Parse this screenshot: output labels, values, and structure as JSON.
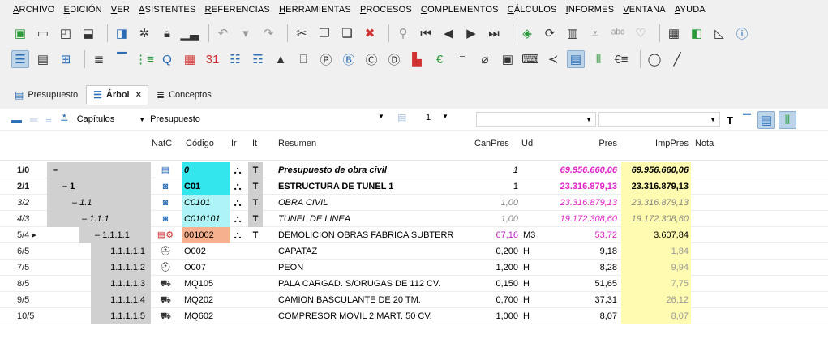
{
  "menu": [
    "ARCHIVO",
    "EDICIÓN",
    "VER",
    "ASISTENTES",
    "REFERENCIAS",
    "HERRAMIENTAS",
    "PROCESOS",
    "COMPLEMENTOS",
    "CÁLCULOS",
    "INFORMES",
    "VENTANA",
    "AYUDA"
  ],
  "tabs": [
    {
      "label": "Presupuesto",
      "icon": "table-icon"
    },
    {
      "label": "Árbol",
      "icon": "tree-icon",
      "close": "×"
    },
    {
      "label": "Conceptos",
      "icon": "list-icon"
    }
  ],
  "filter": {
    "level_label": "Capítulos",
    "view_select": "Presupuesto",
    "count_value": "1"
  },
  "columns": {
    "natc": "NatC",
    "codigo": "Código",
    "ir": "Ir",
    "it": "It",
    "resumen": "Resumen",
    "canpres": "CanPres",
    "ud": "Ud",
    "pres": "Pres",
    "imppres": "ImpPres",
    "nota": "Nota"
  },
  "rows": [
    {
      "id": "1/0",
      "tree": "–",
      "nat": "▤",
      "code": "0",
      "ir": "⛬",
      "it": "T",
      "resumen": "Presupuesto de obra civil",
      "canpres": "1",
      "ud": "",
      "pres": "69.956.660,06",
      "imppres": "69.956.660,06"
    },
    {
      "id": "2/1",
      "tree": "– 1",
      "nat": "◙",
      "code": "C01",
      "ir": "⛬",
      "it": "T",
      "resumen": "ESTRUCTURA DE TUNEL 1",
      "canpres": "1",
      "ud": "",
      "pres": "23.316.879,13",
      "imppres": "23.316.879,13"
    },
    {
      "id": "3/2",
      "tree": "– 1.1",
      "nat": "◙",
      "code": "C0101",
      "ir": "⛬",
      "it": "T",
      "resumen": "OBRA CIVIL",
      "canpres": "1,00",
      "ud": "",
      "pres": "23.316.879,13",
      "imppres": "23.316.879,13"
    },
    {
      "id": "4/3",
      "tree": "– 1.1.1",
      "nat": "◙",
      "code": "C010101",
      "ir": "⛬",
      "it": "T",
      "resumen": "TUNEL DE LINEA",
      "canpres": "1,00",
      "ud": "",
      "pres": "19.172.308,60",
      "imppres": "19.172.308,60"
    },
    {
      "id": "5/4 ▸",
      "tree": "– 1.1.1.1",
      "nat": "▤⚙",
      "code": "001002",
      "ir": "⛬",
      "it": "T",
      "resumen": "DEMOLICION OBRAS FABRICA SUBTERR",
      "canpres": "67,16",
      "ud": "M3",
      "pres": "53,72",
      "imppres": "3.607,84"
    },
    {
      "id": "6/5",
      "tree": "1.1.1.1.1",
      "nat": "⛑",
      "code": "O002",
      "ir": "",
      "it": "",
      "resumen": "CAPATAZ",
      "canpres": "0,200",
      "ud": "H",
      "pres": "9,18",
      "imppres": "1,84"
    },
    {
      "id": "7/5",
      "tree": "1.1.1.1.2",
      "nat": "⛑",
      "code": "O007",
      "ir": "",
      "it": "",
      "resumen": "PEON",
      "canpres": "1,200",
      "ud": "H",
      "pres": "8,28",
      "imppres": "9,94"
    },
    {
      "id": "8/5",
      "tree": "1.1.1.1.3",
      "nat": "⛟",
      "code": "MQ105",
      "ir": "",
      "it": "",
      "resumen": "PALA CARGAD. S/ORUGAS DE 112 CV.",
      "canpres": "0,150",
      "ud": "H",
      "pres": "51,65",
      "imppres": "7,75"
    },
    {
      "id": "9/5",
      "tree": "1.1.1.1.4",
      "nat": "⛟",
      "code": "MQ202",
      "ir": "",
      "it": "",
      "resumen": "CAMION BASCULANTE DE 20 TM.",
      "canpres": "0,700",
      "ud": "H",
      "pres": "37,31",
      "imppres": "26,12"
    },
    {
      "id": "10/5",
      "tree": "1.1.1.1.5",
      "nat": "⛟",
      "code": "MQ602",
      "ir": "",
      "it": "",
      "resumen": "COMPRESOR MOVIL 2 MART. 50 CV.",
      "canpres": "1,000",
      "ud": "H",
      "pres": "8,07",
      "imppres": "8,07"
    }
  ],
  "colors": {
    "code_cyan": "#33e6ee",
    "code_cyan_light": "#aef4f6",
    "code_salmon": "#f7b08e",
    "pres_magenta": "#e020c8",
    "imppres_yellow": "#fffbb0",
    "tree_gray": "#d0d0d0",
    "canpres_purple": "#c020c0"
  }
}
